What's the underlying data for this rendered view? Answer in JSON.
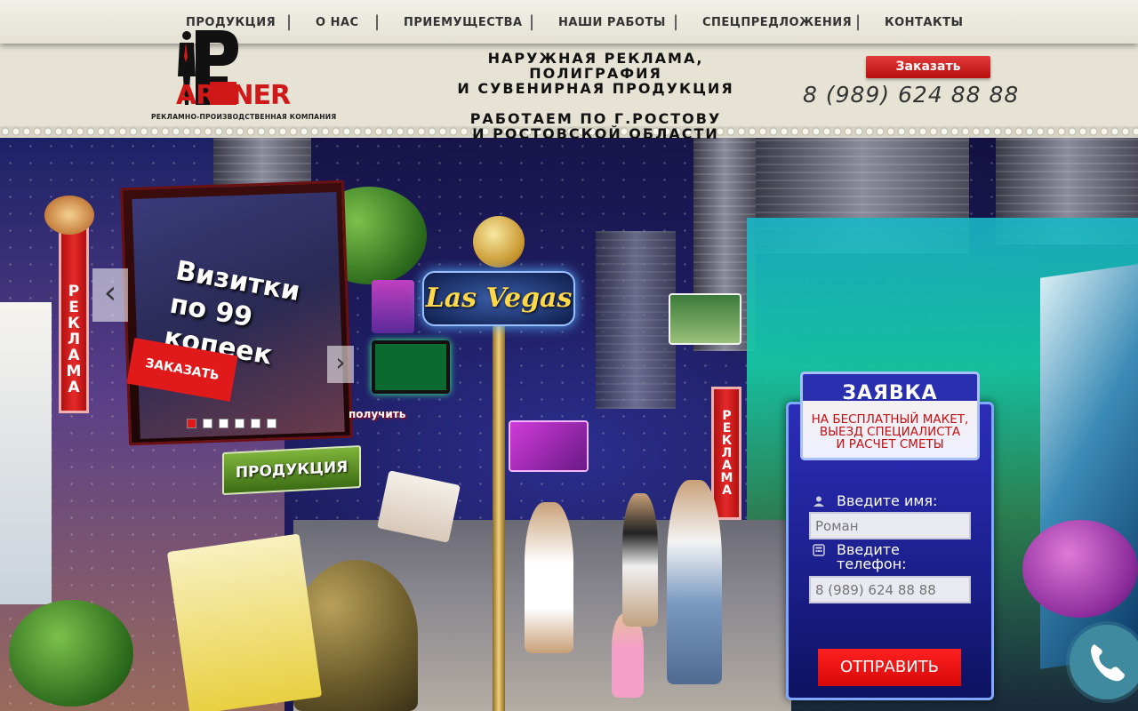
{
  "nav": {
    "items": [
      "ПРОДУКЦИЯ",
      "О НАС",
      "ПРИЕМУЩЕСТВА",
      "НАШИ РАБОТЫ",
      "СПЕЦПРЕДЛОЖЕНИЯ",
      "КОНТАКТЫ"
    ],
    "separator": "|"
  },
  "logo": {
    "wordmark": "ARTNER",
    "subtitle": "РЕКЛАМНО-ПРОИЗВОДСТВЕННАЯ КОМПАНИЯ"
  },
  "header": {
    "tagline_lines": [
      "НАРУЖНАЯ РЕКЛАМА,",
      "ПОЛИГРАФИЯ",
      "И СУВЕНИРНАЯ ПРОДУКЦИЯ"
    ],
    "region_lines": [
      "РАБОТАЕМ ПО Г.РОСТОВУ",
      "И РОСТОВСКОЙ ОБЛАСТИ"
    ],
    "order_label": "Заказать",
    "phone": "8 (989) 624 88 88"
  },
  "hero": {
    "billboard_text": "Визитки по 99 копеек",
    "billboard_order": "ЗАКАЗАТЬ",
    "reklama_left": "РЕКЛАМА",
    "reklama_right": "РЕКЛАМА",
    "product_button": "ПРОДУКЦИЯ",
    "poluchit": "получить",
    "vegas_sign": "Las Vegas",
    "prev_arrow": "‹",
    "next_arrow": "›",
    "slide_count": 6,
    "active_slide": 1
  },
  "form": {
    "title": "ЗАЯВКА",
    "subtitle_lines": [
      "НА БЕСПЛАТНЫЙ МАКЕТ,",
      "ВЫЕЗД СПЕЦИАЛИСТА",
      "И РАСЧЕТ СМЕТЫ"
    ],
    "name_label": "Введите имя:",
    "name_placeholder": "Роман",
    "phone_label_lines": [
      "Введите",
      "телефон:"
    ],
    "phone_placeholder": "8 (989) 624 88 88",
    "submit_label": "ОТПРАВИТЬ"
  },
  "colors": {
    "accent_red": "#e01a1a",
    "form_blue": "#1b1f8a",
    "call_teal": "#3f8a9e"
  },
  "icons": [
    "user-icon",
    "phone-keypad-icon",
    "phone-handset-icon",
    "chevron-left-icon",
    "chevron-right-icon"
  ]
}
